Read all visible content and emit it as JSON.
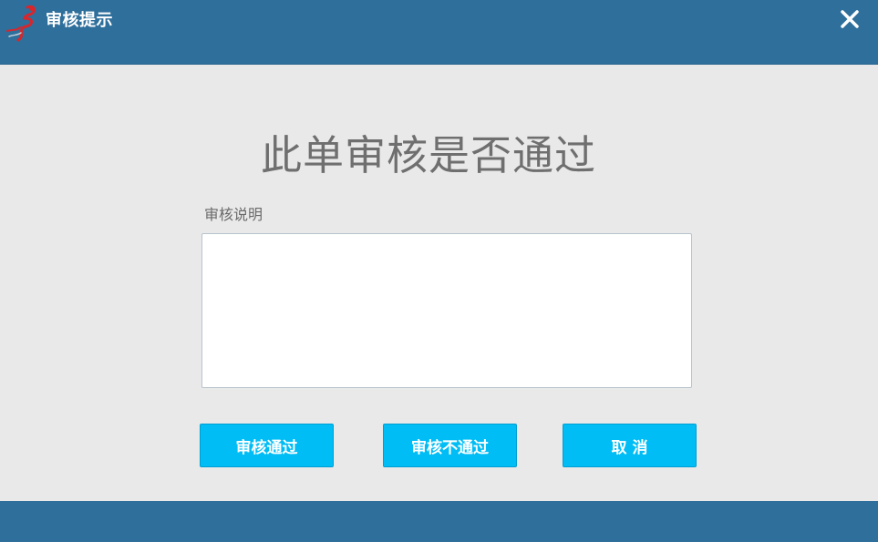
{
  "window": {
    "title": "审核提示",
    "logo_icon": "running-figure-logo",
    "close_icon": "close-icon",
    "titlebar_color": "#2f6f9b"
  },
  "dialog": {
    "heading": "此单审核是否通过",
    "remarks_label": "审核说明",
    "remarks_value": "",
    "remarks_placeholder": ""
  },
  "buttons": {
    "approve_label": "审核通过",
    "reject_label": "审核不通过",
    "cancel_label": "取 消",
    "accent_color": "#00bdf5"
  }
}
